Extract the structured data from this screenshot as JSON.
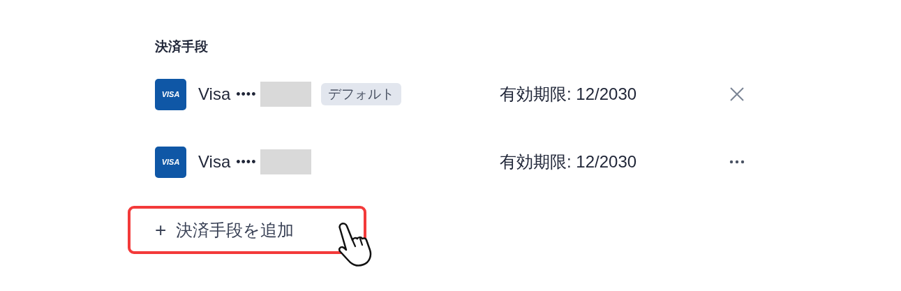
{
  "section_title": "決済手段",
  "payment_methods": [
    {
      "brand_logo": "VISA",
      "brand": "Visa",
      "masked_prefix": "••••",
      "number_hidden": true,
      "badge": "デフォルト",
      "expiry": "有効期限: 12/2030",
      "action": {
        "kind": "remove"
      }
    },
    {
      "brand_logo": "VISA",
      "brand": "Visa",
      "masked_prefix": "••••",
      "number_hidden": true,
      "expiry": "有効期限: 12/2030",
      "action": {
        "kind": "more"
      }
    }
  ],
  "add_button": {
    "icon": "+",
    "label": "決済手段を追加",
    "highlighted": true,
    "cursor": true
  }
}
